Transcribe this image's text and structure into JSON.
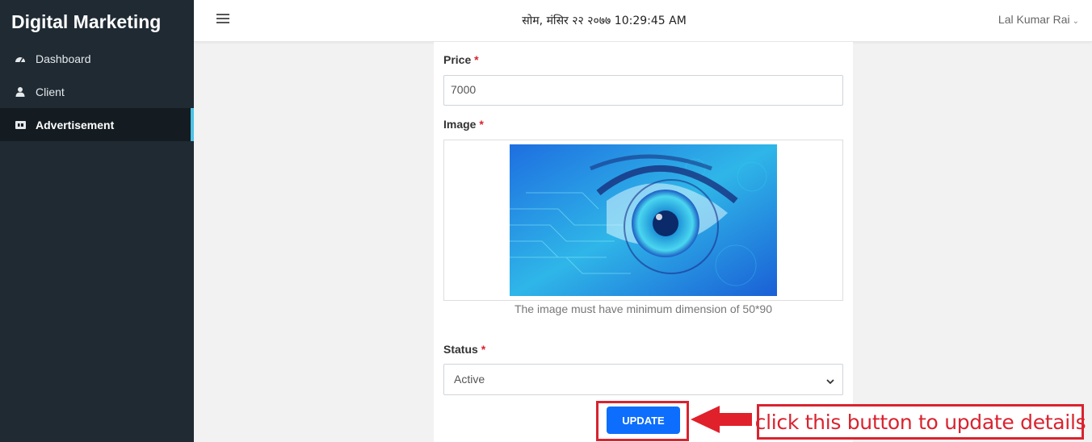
{
  "app": {
    "brand": "Digital Marketing"
  },
  "sidebar": {
    "items": [
      {
        "label": "Dashboard",
        "icon": "dashboard-icon",
        "active": false
      },
      {
        "label": "Client",
        "icon": "user-icon",
        "active": false
      },
      {
        "label": "Advertisement",
        "icon": "ad-icon",
        "active": true
      }
    ]
  },
  "topbar": {
    "datetime": "सोम, मंसिर २२ २०७७ 10:29:45 AM",
    "user": "Lal Kumar Rai"
  },
  "form": {
    "price": {
      "label": "Price",
      "required": "*",
      "value": "7000"
    },
    "image": {
      "label": "Image",
      "required": "*",
      "hint": "The image must have minimum dimension of 50*90"
    },
    "status": {
      "label": "Status",
      "required": "*",
      "value": "Active"
    },
    "update_label": "UPDATE"
  },
  "annotation": {
    "text": "click this button to update details"
  },
  "colors": {
    "sidebar_bg": "#1f2a33",
    "active_accent": "#4ec2e6",
    "primary": "#0d6efd",
    "annotation_red": "#d9232f"
  }
}
